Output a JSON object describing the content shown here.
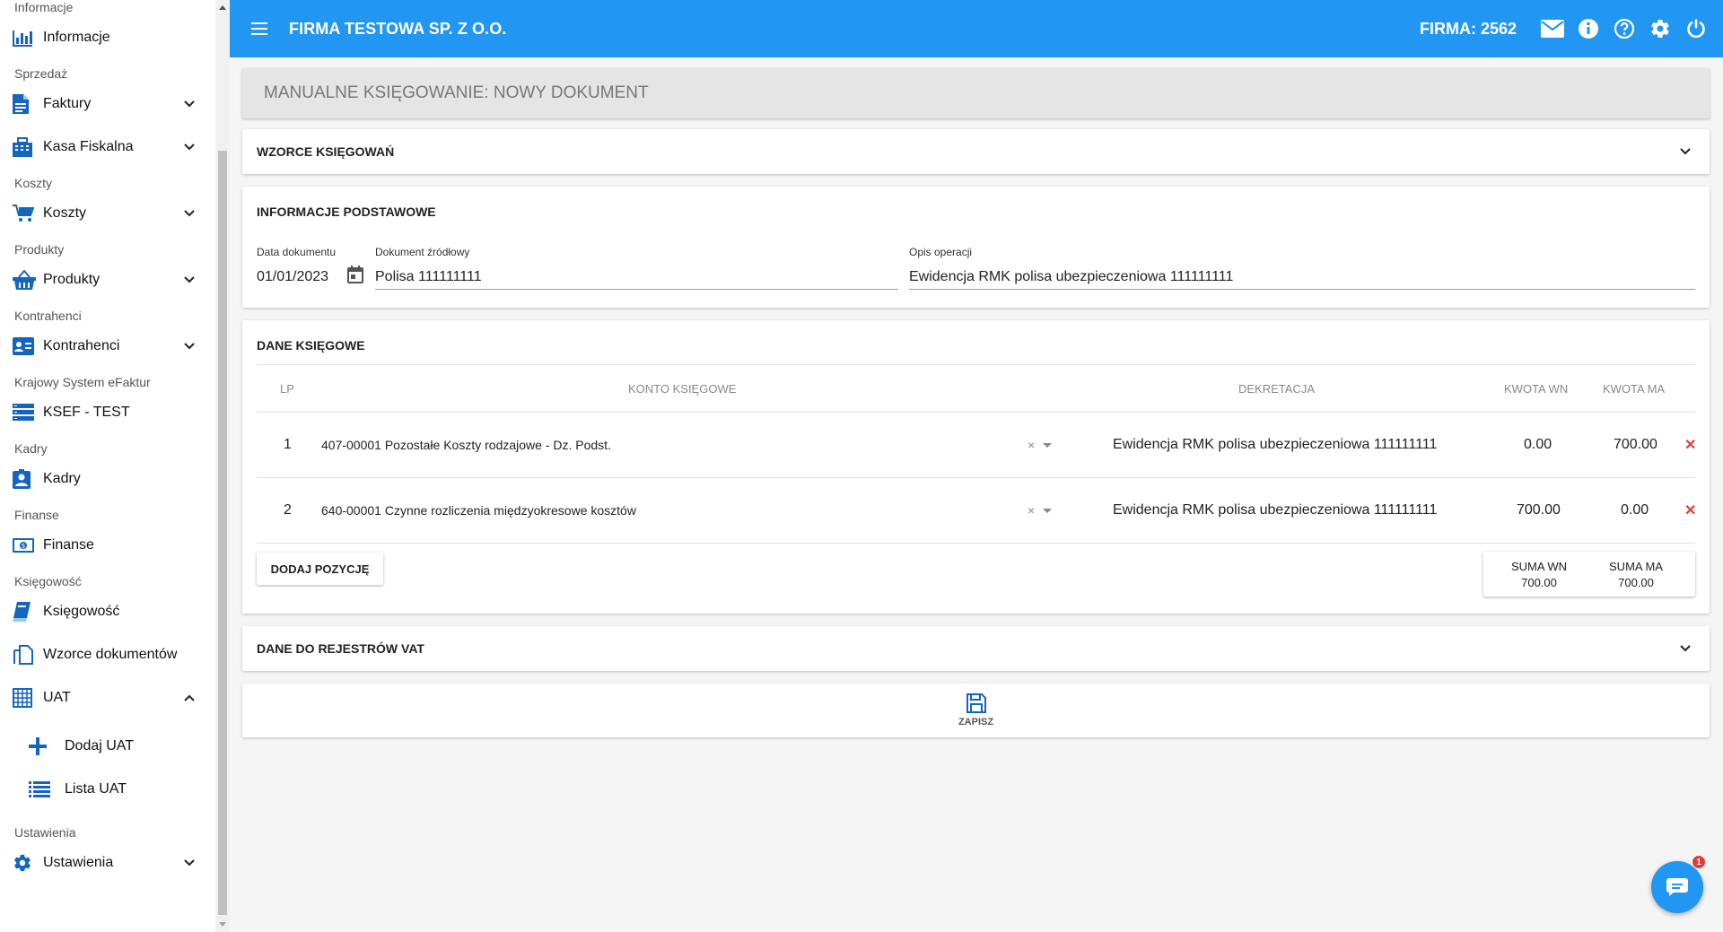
{
  "colors": {
    "primary": "#2196f3",
    "nav_icon": "#1565c0",
    "delete": "#e53935"
  },
  "sidebar": {
    "sections": [
      {
        "title": "Informacje",
        "items": [
          {
            "label": "Informacje",
            "icon": "bar-chart-icon",
            "expandable": false
          }
        ]
      },
      {
        "title": "Sprzedaż",
        "items": [
          {
            "label": "Faktury",
            "icon": "document-icon",
            "expandable": true
          },
          {
            "label": "Kasa Fiskalna",
            "icon": "cash-register-icon",
            "expandable": true
          }
        ]
      },
      {
        "title": "Koszty",
        "items": [
          {
            "label": "Koszty",
            "icon": "cart-icon",
            "expandable": true
          }
        ]
      },
      {
        "title": "Produkty",
        "items": [
          {
            "label": "Produkty",
            "icon": "basket-icon",
            "expandable": true
          }
        ]
      },
      {
        "title": "Kontrahenci",
        "items": [
          {
            "label": "Kontrahenci",
            "icon": "contact-card-icon",
            "expandable": true
          }
        ]
      },
      {
        "title": "Krajowy System eFaktur",
        "items": [
          {
            "label": "KSEF - TEST",
            "icon": "server-icon",
            "expandable": false
          }
        ]
      },
      {
        "title": "Kadry",
        "items": [
          {
            "label": "Kadry",
            "icon": "person-badge-icon",
            "expandable": false
          }
        ]
      },
      {
        "title": "Finanse",
        "items": [
          {
            "label": "Finanse",
            "icon": "money-icon",
            "expandable": false
          }
        ]
      },
      {
        "title": "Księgowość",
        "items": [
          {
            "label": "Księgowość",
            "icon": "book-icon",
            "expandable": false
          },
          {
            "label": "Wzorce dokumentów",
            "icon": "copy-documents-icon",
            "expandable": false
          },
          {
            "label": "UAT",
            "icon": "grid-icon",
            "expandable": true,
            "expanded": true,
            "children": [
              {
                "label": "Dodaj UAT",
                "icon": "plus-icon"
              },
              {
                "label": "Lista UAT",
                "icon": "list-icon"
              }
            ]
          }
        ]
      },
      {
        "title": "Ustawienia",
        "items": [
          {
            "label": "Ustawienia",
            "icon": "gear-icon",
            "expandable": true
          }
        ]
      }
    ]
  },
  "topbar": {
    "company": "FIRMA TESTOWA SP. Z O.O.",
    "firma": "FIRMA: 2562",
    "icons": [
      "mail-icon",
      "info-icon",
      "help-icon",
      "settings-icon",
      "power-icon"
    ]
  },
  "page": {
    "title": "MANUALNE KSIĘGOWANIE: NOWY DOKUMENT",
    "templates_panel": "WZORCE KSIĘGOWAŃ",
    "basic_info": {
      "title": "INFORMACJE PODSTAWOWE",
      "date_label": "Data dokumentu",
      "date_value": "01/01/2023",
      "source_label": "Dokument źródłowy",
      "source_value": "Polisa 111111111",
      "desc_label": "Opis operacji",
      "desc_value": "Ewidencja RMK polisa ubezpieczeniowa 111111111"
    },
    "accounting": {
      "title": "DANE KSIĘGOWE",
      "columns": {
        "lp": "LP",
        "account": "KONTO KSIĘGOWE",
        "decree": "DEKRETACJA",
        "wn": "KWOTA WN",
        "ma": "KWOTA MA"
      },
      "rows": [
        {
          "lp": "1",
          "account": "407-00001 Pozostałe Koszty rodzajowe - Dz. Podst.",
          "decree": "Ewidencja RMK polisa ubezpieczeniowa 111111111",
          "wn": "0.00",
          "ma": "700.00"
        },
        {
          "lp": "2",
          "account": "640-00001 Czynne rozliczenia międzyokresowe kosztów",
          "decree": "Ewidencja RMK polisa ubezpieczeniowa 111111111",
          "wn": "700.00",
          "ma": "0.00"
        }
      ],
      "add_button": "DODAJ POZYCJĘ",
      "sum_wn_label": "SUMA WN",
      "sum_wn_value": "700.00",
      "sum_ma_label": "SUMA MA",
      "sum_ma_value": "700.00"
    },
    "vat_panel": "DANE DO REJESTRÓW VAT",
    "save_label": "ZAPISZ"
  },
  "chat": {
    "badge": "1"
  }
}
